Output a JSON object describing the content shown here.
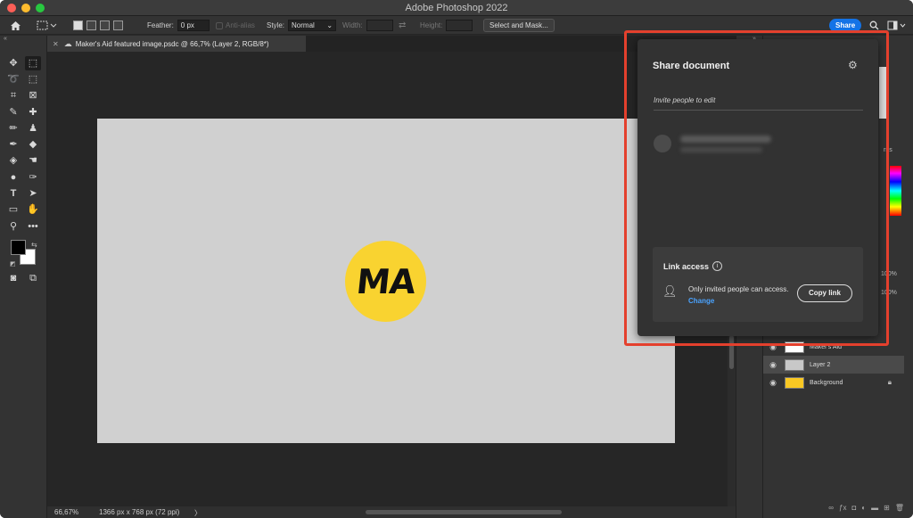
{
  "app": {
    "title": "Adobe Photoshop 2022"
  },
  "options_bar": {
    "feather_label": "Feather:",
    "feather_value": "0 px",
    "anti_alias_label": "Anti-alias",
    "style_label": "Style:",
    "style_value": "Normal",
    "width_label": "Width:",
    "height_label": "Height:",
    "select_mask_label": "Select and Mask...",
    "share_label": "Share"
  },
  "document_tab": {
    "label": "Maker's Aid featured image.psdc @ 66,7% (Layer 2, RGB/8*)"
  },
  "canvas": {
    "logo_text": "MA",
    "background_color": "#d0d0d0",
    "logo_color": "#f9d330"
  },
  "status_bar": {
    "zoom": "66,67%",
    "dimensions": "1366 px x 768 px (72 ppi)",
    "arrow": "〉"
  },
  "share_panel": {
    "title": "Share document",
    "invite_placeholder": "Invite people to edit",
    "link_access_title": "Link access",
    "access_text": "Only invited people can access.",
    "change_label": "Change",
    "copy_link_label": "Copy link"
  },
  "right_panel": {
    "partial_tab": "rns",
    "opacity_value": "100%",
    "fill_value": "100%"
  },
  "layers": [
    {
      "name": "Maker's Aid",
      "visible": true,
      "thumb": "#ffffff",
      "selected": false,
      "locked": false
    },
    {
      "name": "Layer 2",
      "visible": true,
      "thumb": "#c8c8c8",
      "selected": true,
      "locked": false
    },
    {
      "name": "Background",
      "visible": true,
      "thumb": "#f9c823",
      "selected": false,
      "locked": true
    }
  ],
  "colors": {
    "accent": "#1473e6",
    "annotation": "#e4402d",
    "link": "#4aa3ff"
  }
}
